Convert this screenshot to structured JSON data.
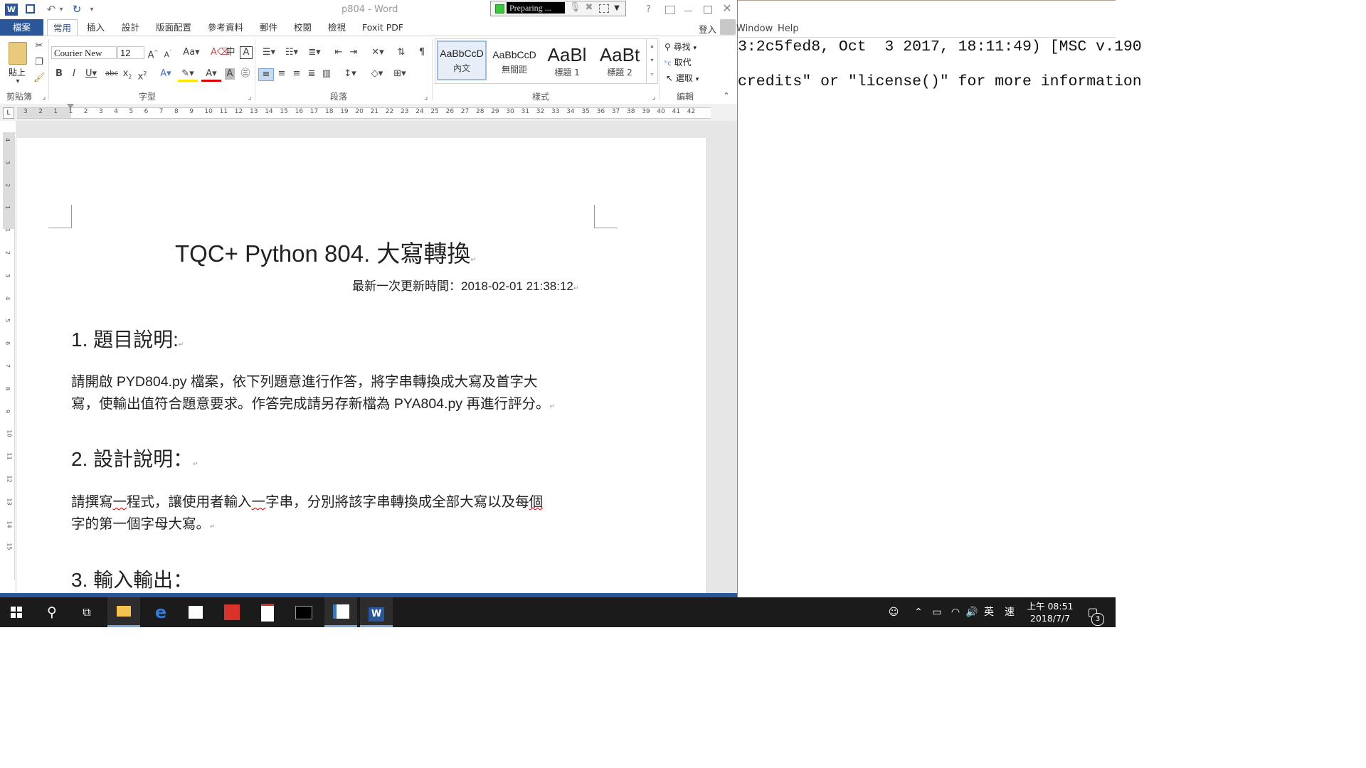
{
  "word": {
    "title": "p804 - Word",
    "recorder_status": "Preparing ...",
    "help_icon": "?",
    "tabs": [
      "檔案",
      "常用",
      "插入",
      "設計",
      "版面配置",
      "參考資料",
      "郵件",
      "校閱",
      "檢視",
      "Foxit PDF"
    ],
    "sign_in": "登入",
    "font_name": "Courier New",
    "font_size": "12",
    "paste_label": "貼上",
    "groups": {
      "clipboard": "剪貼簿",
      "font": "字型",
      "paragraph": "段落",
      "styles": "樣式",
      "editing": "編輯"
    },
    "styles": [
      {
        "sample": "AaBbCcD",
        "name": "內文"
      },
      {
        "sample": "AaBbCcD",
        "name": "無間距"
      },
      {
        "sample": "AaBl",
        "name": "標題 1"
      },
      {
        "sample": "AaBt",
        "name": "標題 2"
      }
    ],
    "editing": {
      "find": "尋找",
      "replace": "取代",
      "select": "選取"
    },
    "ruler_numbers": [
      "3",
      "2",
      "1",
      "1",
      "2",
      "3",
      "4",
      "5",
      "6",
      "7",
      "8",
      "9",
      "10",
      "11",
      "12",
      "13",
      "14",
      "15",
      "16",
      "17",
      "18",
      "19",
      "20",
      "21",
      "22",
      "23",
      "24",
      "25",
      "26",
      "27",
      "28",
      "29",
      "30",
      "31",
      "32",
      "33",
      "34",
      "35",
      "36",
      "37",
      "38",
      "39",
      "40",
      "41",
      "42"
    ],
    "vruler_numbers": [
      "4",
      "3",
      "2",
      "1",
      "1",
      "2",
      "3",
      "4",
      "5",
      "6",
      "7",
      "8",
      "9",
      "10",
      "11",
      "12",
      "13",
      "14",
      "15"
    ]
  },
  "document": {
    "title": "TQC+ Python 804.  大寫轉換",
    "updated": "最新一次更新時間：2018-02-01 21:38:12",
    "h1": "1.  題目說明:",
    "p1_line1": "請開啟 PYD804.py 檔案，依下列題意進行作答，將字串轉換成大寫及首字大",
    "p1_line2": "寫，使輸出值符合題意要求。作答完成請另存新檔為 PYA804.py 再進行評分。",
    "h2": "2.  設計說明：",
    "p2_l1_a": "請撰寫",
    "p2_l1_b": "一",
    "p2_l1_c": "程式，讓使用者輸入",
    "p2_l1_d": "一",
    "p2_l1_e": "字串，分別將該字串轉換成全部大寫以及每",
    "p2_l1_f": "個",
    "p2_line2": "字的第一個字母大寫。",
    "h3": "3.  輸入輸出："
  },
  "python_window": {
    "menu": [
      "Window",
      "Help"
    ],
    "line1": "3:2c5fed8, Oct  3 2017, 18:11:49) [MSC v.190",
    "line2": "credits\" or \"license()\" for more information"
  },
  "taskbar": {
    "clock_time": "上午 08:51",
    "clock_date": "2018/7/7",
    "ime_lang": "英",
    "ime_mode": "速",
    "notification_count": "3"
  }
}
